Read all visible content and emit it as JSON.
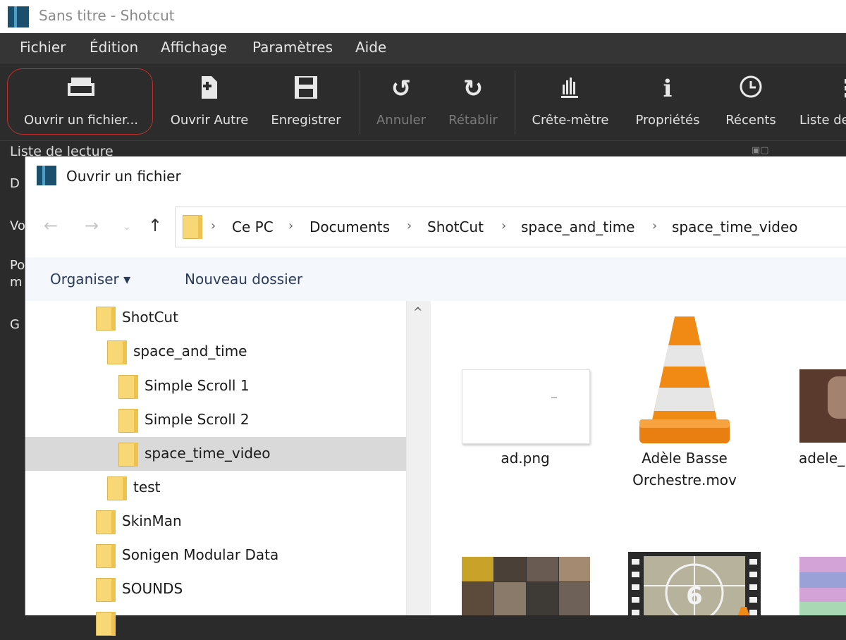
{
  "window": {
    "title": "Sans titre - Shotcut"
  },
  "menu": [
    "Fichier",
    "Édition",
    "Affichage",
    "Paramètres",
    "Aide"
  ],
  "toolbar": {
    "open_file": "Ouvrir un fichier...",
    "open_other": "Ouvrir Autre",
    "save": "Enregistrer",
    "undo": "Annuler",
    "redo": "Rétablir",
    "peak_meter": "Crête-mètre",
    "properties": "Propriétés",
    "recents": "Récents",
    "playlist": "Liste de"
  },
  "panel": {
    "title": "Liste de lecture",
    "side_letters": [
      "D",
      "Vo",
      "Po",
      "m",
      "G"
    ]
  },
  "dialog": {
    "title": "Ouvrir un fichier",
    "breadcrumb": [
      "Ce PC",
      "Documents",
      "ShotCut",
      "space_and_time",
      "space_time_video"
    ],
    "organize": "Organiser ▾",
    "new_folder": "Nouveau dossier",
    "tree": [
      {
        "label": "ShotCut",
        "indent": 1
      },
      {
        "label": "space_and_time",
        "indent": 2
      },
      {
        "label": "Simple Scroll 1",
        "indent": 3
      },
      {
        "label": "Simple Scroll 2",
        "indent": 3
      },
      {
        "label": "space_time_video",
        "indent": 3,
        "selected": true
      },
      {
        "label": "test",
        "indent": 2
      },
      {
        "label": "SkinMan",
        "indent": 1
      },
      {
        "label": "Sonigen Modular Data",
        "indent": 1
      },
      {
        "label": "SOUNDS",
        "indent": 1
      }
    ],
    "files": [
      {
        "name": "ad.png"
      },
      {
        "name_line1": "Adèle Basse",
        "name_line2": "Orchestre.mov"
      },
      {
        "name": "adele_"
      }
    ]
  },
  "colors": {
    "highlight_ring": "#c0302b",
    "vlc_orange": "#f08a14",
    "folder_yellow": "#f8d775"
  },
  "icons": [
    "folder-open-icon",
    "new-file-icon",
    "save-icon",
    "undo-icon",
    "redo-icon",
    "peak-meter-icon",
    "info-icon",
    "clock-icon"
  ]
}
